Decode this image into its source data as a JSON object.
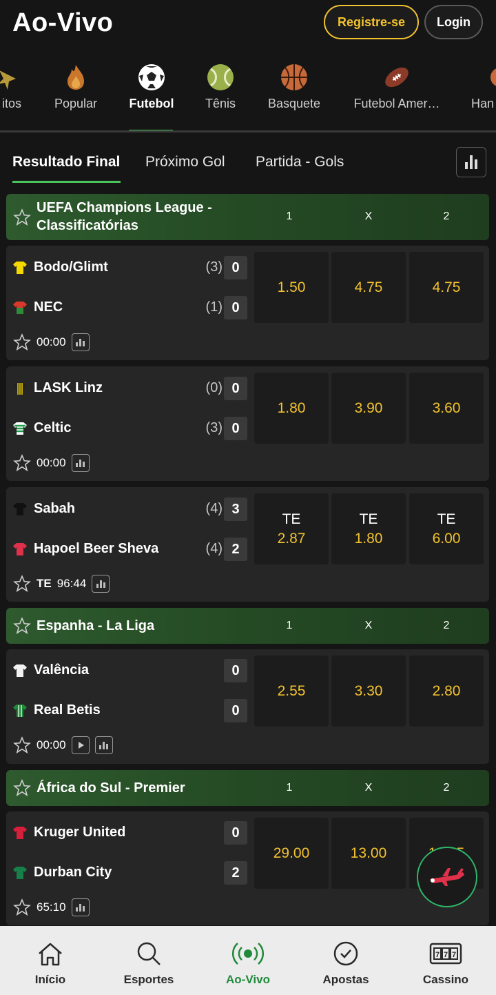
{
  "header": {
    "logo": "Ao-Vivo",
    "register_label": "Registre-se",
    "login_label": "Login"
  },
  "sports_nav": [
    {
      "label": "itos",
      "icon": "star-icon"
    },
    {
      "label": "Popular",
      "icon": "fire-icon"
    },
    {
      "label": "Futebol",
      "icon": "soccer-ball-icon",
      "active": true
    },
    {
      "label": "Tênis",
      "icon": "tennis-ball-icon"
    },
    {
      "label": "Basquete",
      "icon": "basketball-icon"
    },
    {
      "label": "Futebol Amer…",
      "icon": "american-football-icon"
    },
    {
      "label": "Han",
      "icon": "handball-icon"
    }
  ],
  "market_tabs": [
    {
      "label": "Resultado Final",
      "active": true
    },
    {
      "label": "Próximo Gol"
    },
    {
      "label": "Partida - Gols"
    }
  ],
  "columns": {
    "home": "1",
    "draw": "X",
    "away": "2"
  },
  "leagues": [
    {
      "name_line1": "UEFA Champions League -",
      "name_line2": "Classificatórias"
    },
    {
      "name": "Espanha - La Liga"
    },
    {
      "name": "África do Sul - Premier"
    }
  ],
  "matches": [
    {
      "home": "Bodo/Glimt",
      "home_agg": "(3)",
      "home_score": "0",
      "away": "NEC",
      "away_agg": "(1)",
      "away_score": "0",
      "time": "00:00",
      "odds": [
        "1.50",
        "4.75",
        "4.75"
      ]
    },
    {
      "home": "LASK Linz",
      "home_agg": "(0)",
      "home_score": "0",
      "away": "Celtic",
      "away_agg": "(3)",
      "away_score": "0",
      "time": "00:00",
      "odds": [
        "1.80",
        "3.90",
        "3.60"
      ]
    },
    {
      "home": "Sabah",
      "home_agg": "(4)",
      "home_score": "3",
      "away": "Hapoel Beer Sheva",
      "away_agg": "(4)",
      "away_score": "2",
      "period": "TE",
      "time": "96:44",
      "odds_prefix": "TE",
      "odds": [
        "2.87",
        "1.80",
        "6.00"
      ]
    },
    {
      "home": "Valência",
      "home_score": "0",
      "away": "Real Betis",
      "away_score": "0",
      "time": "00:00",
      "odds": [
        "2.55",
        "3.30",
        "2.80"
      ]
    },
    {
      "home": "Kruger United",
      "home_score": "0",
      "away": "Durban City",
      "away_score": "2",
      "time": "65:10",
      "odds": [
        "29.00",
        "13.00",
        "1.025"
      ]
    }
  ],
  "bottom_nav": [
    {
      "label": "Início",
      "icon": "home-icon"
    },
    {
      "label": "Esportes",
      "icon": "search-icon"
    },
    {
      "label": "Ao-Vivo",
      "icon": "live-broadcast-icon",
      "active": true
    },
    {
      "label": "Apostas",
      "icon": "check-circle-icon"
    },
    {
      "label": "Cassino",
      "icon": "slot-machine-icon"
    }
  ],
  "colors": {
    "accent_green": "#4cc35a",
    "odds_yellow": "#f2c230",
    "league_green": "#2e5a2e",
    "card_bg": "#262626"
  }
}
